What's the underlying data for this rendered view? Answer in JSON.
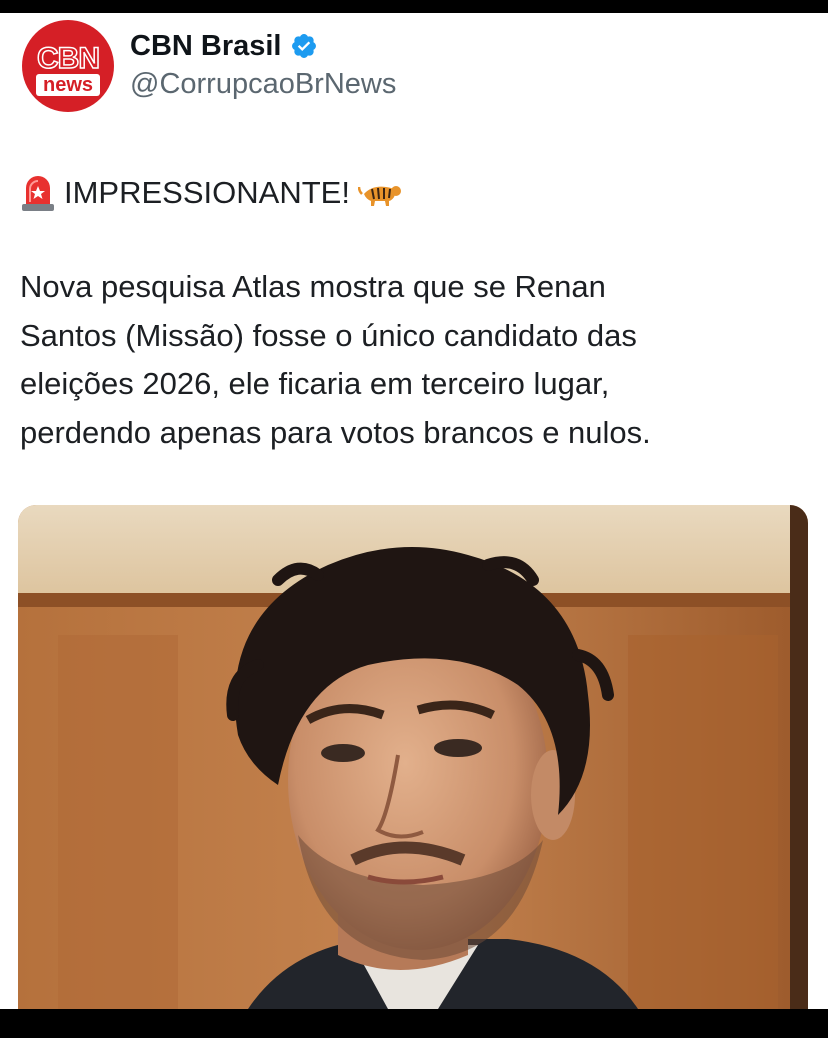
{
  "account": {
    "display_name": "CBN Brasil",
    "handle": "@CorrupcaoBrNews",
    "avatar_logo_top": "CBN",
    "avatar_logo_bottom": "news",
    "verified": true,
    "verified_color": "#1d9bf0"
  },
  "post": {
    "headline": "IMPRESSIONANTE!",
    "headline_prefix_icon": "siren-emoji",
    "headline_suffix_icon": "tiger-emoji",
    "body_lines": [
      "Nova pesquisa Atlas mostra que se Renan",
      "Santos (Missão) fosse o único candidato das",
      "eleições 2026, ele ficaria em terceiro lugar,",
      "perdendo apenas para votos brancos e nulos."
    ]
  },
  "media": {
    "type": "photo",
    "icon": "portrait-photo"
  },
  "colors": {
    "brand_red": "#d51f26",
    "text": "#1c1f23",
    "muted": "#5b6770"
  }
}
